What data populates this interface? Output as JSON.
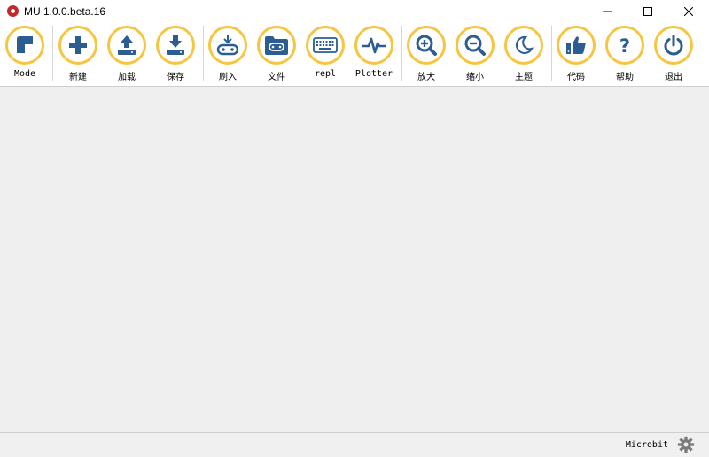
{
  "window": {
    "title": "MU 1.0.0.beta.16",
    "minimize_glyph": "—",
    "maximize_glyph": "☐",
    "close_glyph": "✕"
  },
  "toolbar": {
    "buttons": [
      {
        "id": "mode",
        "label": "Mode",
        "icon": "mode-icon"
      },
      {
        "id": "new",
        "label": "新建",
        "icon": "plus-icon"
      },
      {
        "id": "load",
        "label": "加载",
        "icon": "upload-icon"
      },
      {
        "id": "save",
        "label": "保存",
        "icon": "download-icon"
      },
      {
        "id": "flash",
        "label": "刷入",
        "icon": "flash-icon"
      },
      {
        "id": "files",
        "label": "文件",
        "icon": "folder-icon"
      },
      {
        "id": "repl",
        "label": "repl",
        "icon": "keyboard-icon"
      },
      {
        "id": "plotter",
        "label": "Plotter",
        "icon": "pulse-icon"
      },
      {
        "id": "zoom_in",
        "label": "放大",
        "icon": "zoom-in-icon"
      },
      {
        "id": "zoom_out",
        "label": "缩小",
        "icon": "zoom-out-icon"
      },
      {
        "id": "theme",
        "label": "主题",
        "icon": "moon-icon"
      },
      {
        "id": "check",
        "label": "代码",
        "icon": "thumbs-up-icon"
      },
      {
        "id": "help",
        "label": "帮助",
        "icon": "question-icon"
      },
      {
        "id": "quit",
        "label": "退出",
        "icon": "power-icon"
      }
    ]
  },
  "statusbar": {
    "mode": "Microbit",
    "settings_icon": "gear-icon"
  },
  "colors": {
    "icon": "#2c5d92",
    "ring": "#f6c643",
    "background": "#f0f0f0"
  }
}
